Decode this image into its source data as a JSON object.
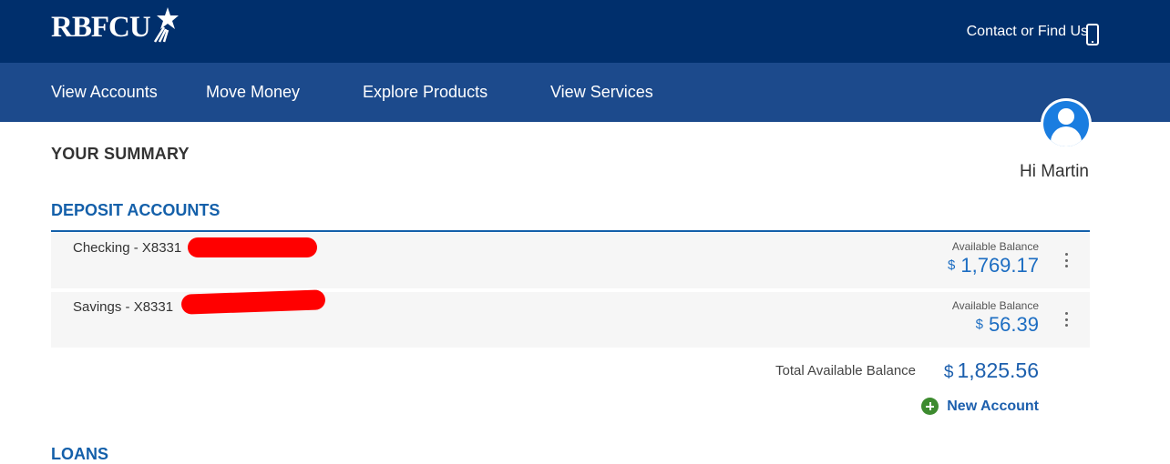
{
  "header": {
    "logo_text": "RBFCU",
    "contact_label": "Contact or Find Us"
  },
  "nav": {
    "items": [
      {
        "label": "View Accounts"
      },
      {
        "label": "Move Money"
      },
      {
        "label": "Explore Products"
      },
      {
        "label": "View Services"
      }
    ]
  },
  "user": {
    "greeting": "Hi Martin"
  },
  "summary": {
    "title": "YOUR SUMMARY",
    "deposit_section_title": "DEPOSIT ACCOUNTS",
    "accounts": [
      {
        "name": "Checking - X8331",
        "balance_label": "Available Balance",
        "currency": "$",
        "balance": "1,769.17"
      },
      {
        "name": "Savings - X8331",
        "balance_label": "Available Balance",
        "currency": "$",
        "balance": "56.39"
      }
    ],
    "total_label": "Total Available Balance",
    "total_currency": "$",
    "total_value": "1,825.56",
    "new_account_label": "New Account",
    "loans_section_title": "LOANS"
  },
  "colors": {
    "header_bg": "#002f6c",
    "nav_bg": "#1c4a8c",
    "accent_blue": "#1460aa",
    "balance_blue": "#1c6dc2",
    "add_green": "#3d8b2f",
    "redaction": "#ff0000"
  }
}
